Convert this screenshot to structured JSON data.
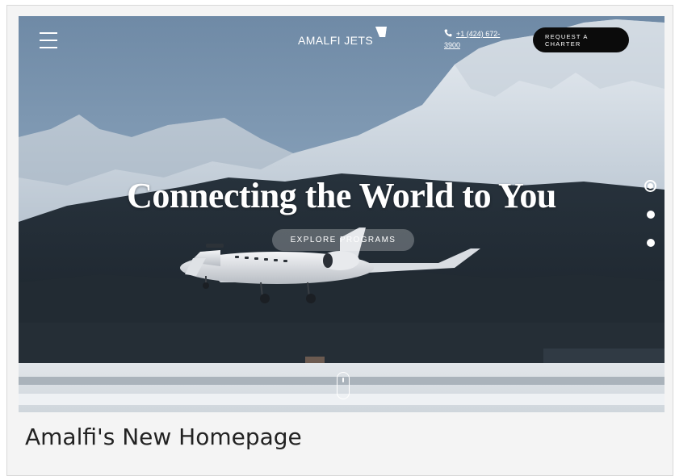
{
  "header": {
    "menu_icon": "hamburger-menu-icon",
    "logo_text": "AMALFI JETS",
    "logo_icon": "triangle-logo-mark",
    "phone_icon": "phone-icon",
    "phone_line1": "+1 (424) 672-",
    "phone_line2": "3900",
    "cta_line1": "REQUEST A",
    "cta_line2": "CHARTER"
  },
  "hero": {
    "headline": "Connecting the World to You",
    "explore_label": "EXPLORE PROGRAMS",
    "background_description_icon": "private-jet-over-snowy-mountains",
    "slides": [
      "slide-1",
      "slide-2",
      "slide-3"
    ],
    "active_slide": 0,
    "scroll_icon": "mouse-scroll-icon"
  },
  "caption": {
    "text": "Amalfi's New Homepage"
  },
  "colors": {
    "cta_background": "#0b0b0b",
    "text_light": "#ffffff",
    "caption_text": "#222222"
  }
}
